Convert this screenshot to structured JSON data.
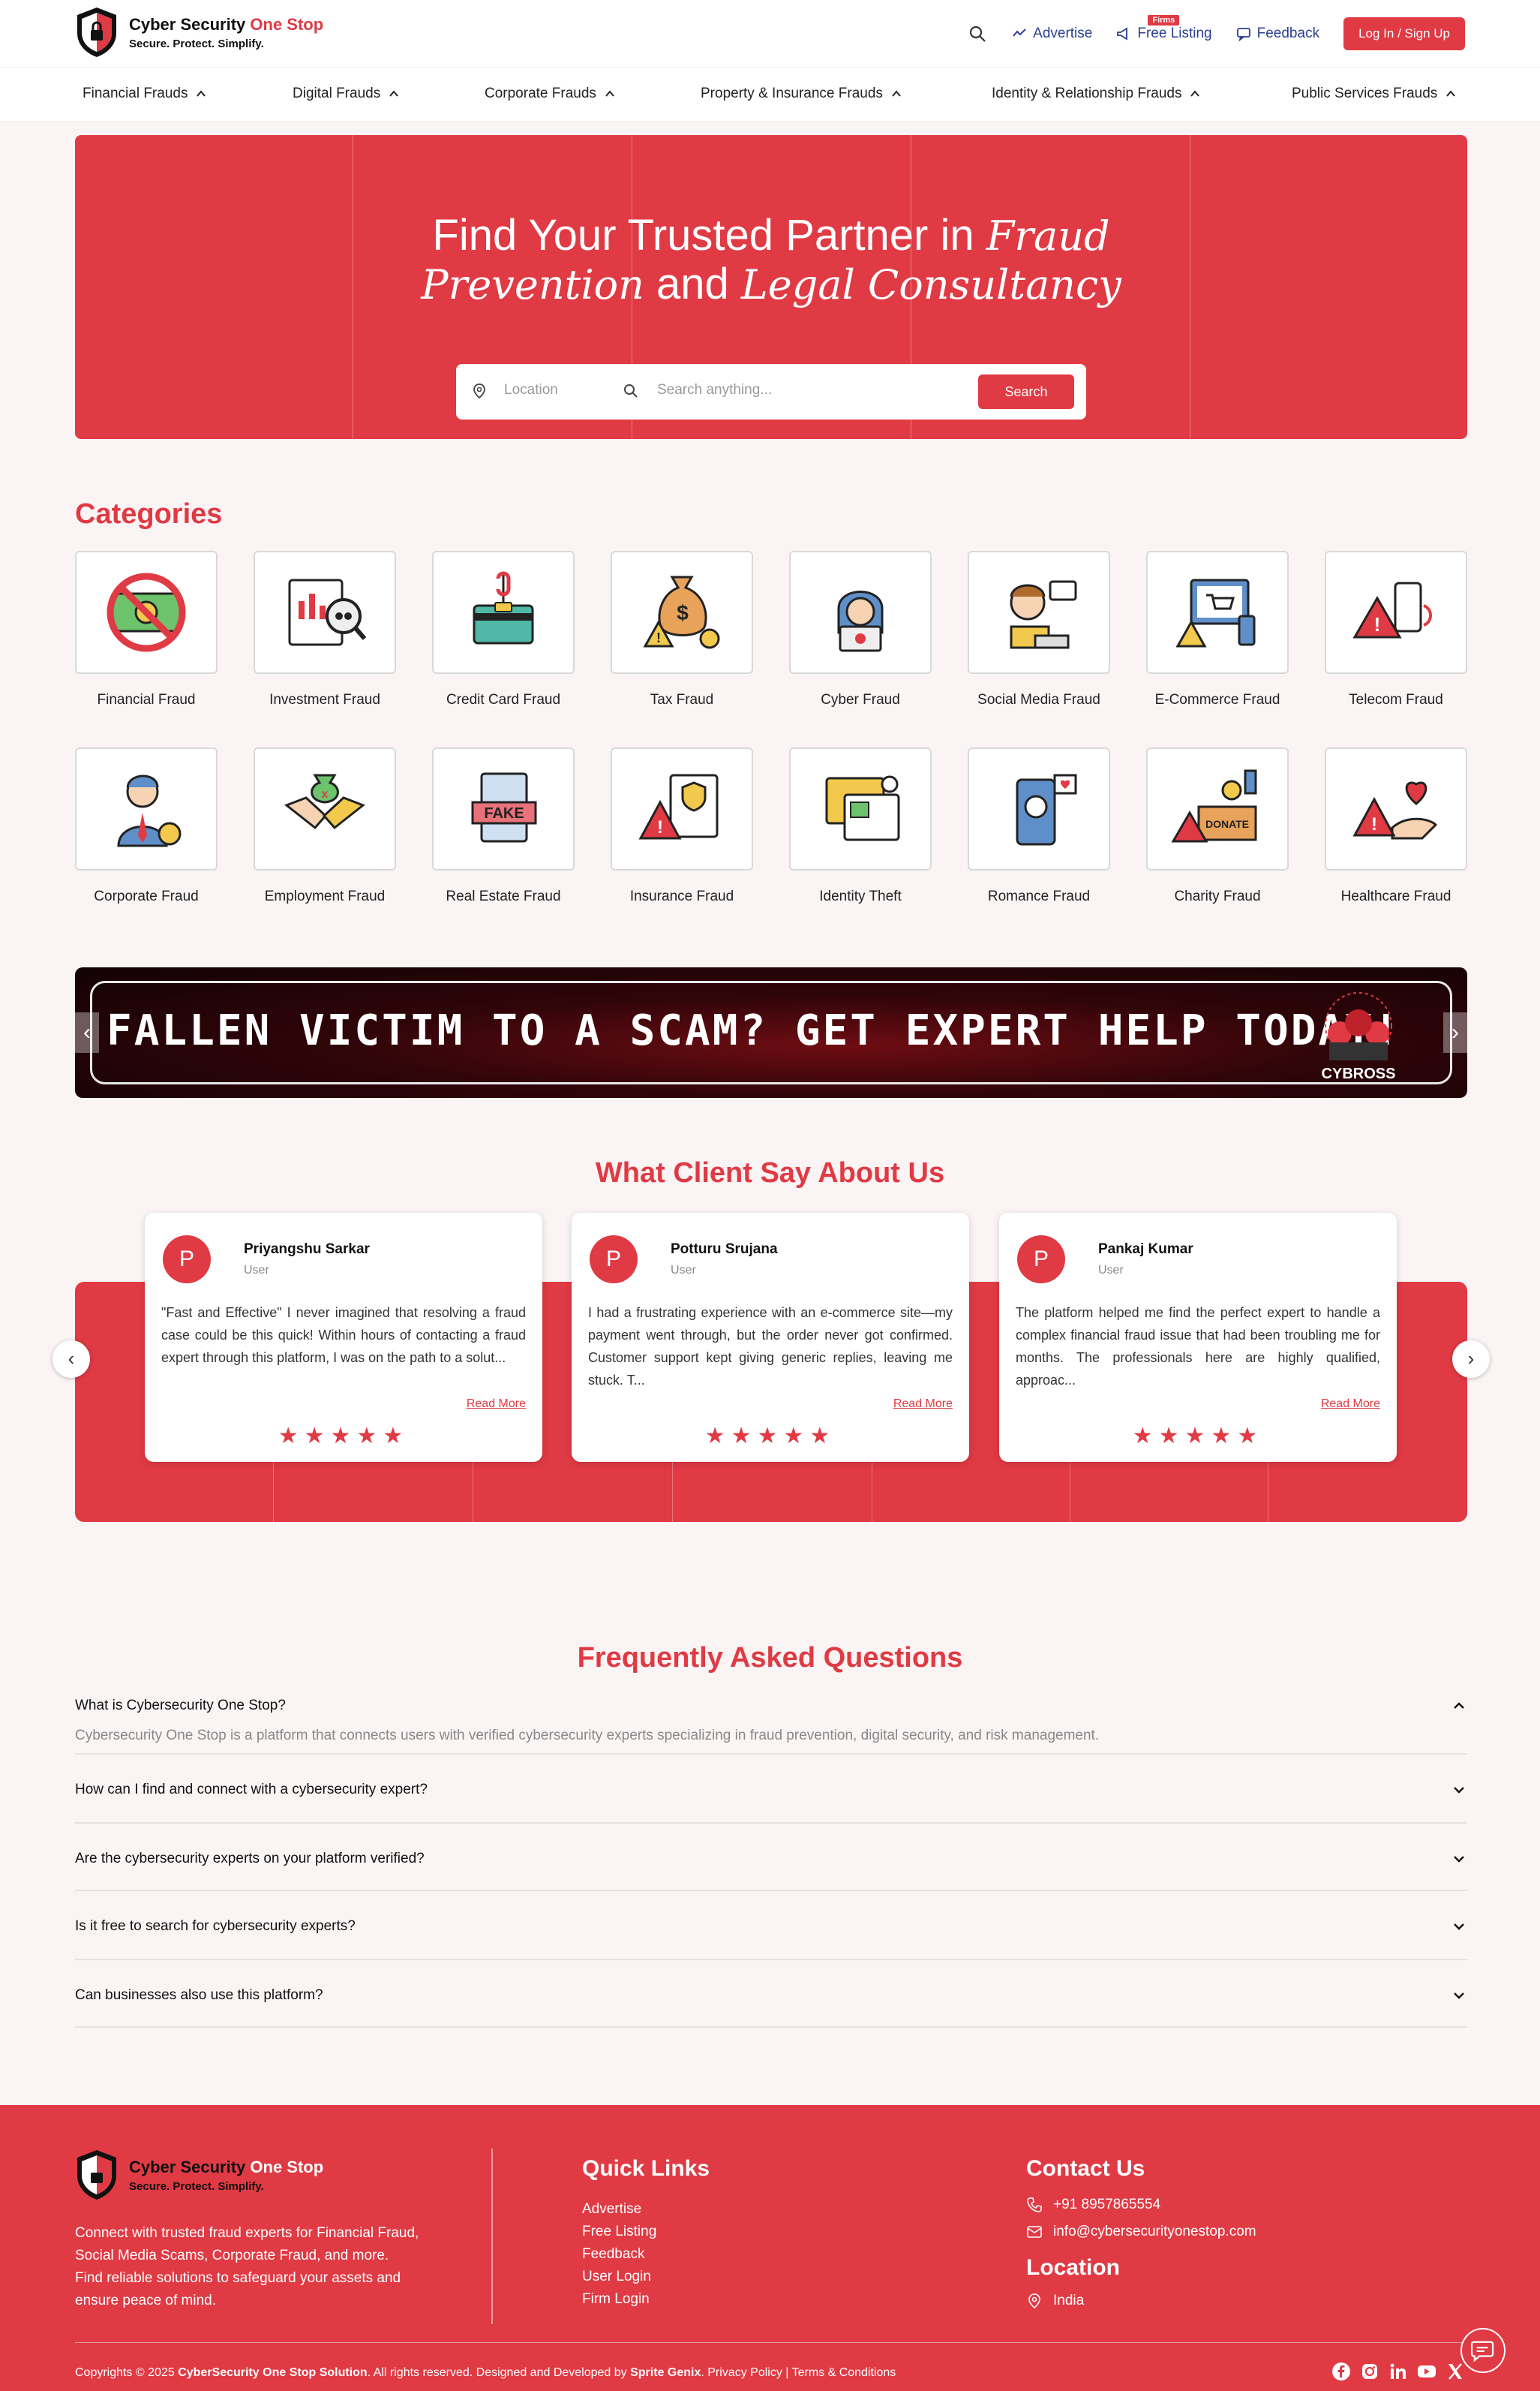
{
  "header": {
    "logo_title_1": "Cyber Security ",
    "logo_title_2": "One Stop",
    "logo_tagline": "Secure. Protect. Simplify.",
    "advertise": "Advertise",
    "free_listing": "Free Listing",
    "firms_badge": "Firms",
    "feedback": "Feedback",
    "login": "Log In / Sign Up"
  },
  "catnav": [
    "Financial Frauds",
    "Digital Frauds",
    "Corporate Frauds",
    "Property & Insurance Frauds",
    "Identity & Relationship Frauds",
    "Public Services Frauds"
  ],
  "hero": {
    "title_1": "Find Your Trusted Partner in ",
    "title_script_1": "Fraud",
    "title_script_2": "Prevention",
    "title_2": " and ",
    "title_script_3": "Legal Consultancy",
    "location_placeholder": "Location",
    "search_placeholder": "Search anything...",
    "search_button": "Search"
  },
  "categories": {
    "title": "Categories",
    "items": [
      {
        "label": "Financial Fraud",
        "icon": "no-money-icon"
      },
      {
        "label": "Investment Fraud",
        "icon": "investment-report-icon"
      },
      {
        "label": "Credit Card Fraud",
        "icon": "credit-card-hook-icon"
      },
      {
        "label": "Tax Fraud",
        "icon": "money-bag-warning-icon"
      },
      {
        "label": "Cyber Fraud",
        "icon": "hacker-icon"
      },
      {
        "label": "Social Media Fraud",
        "icon": "social-media-user-icon"
      },
      {
        "label": "E-Commerce Fraud",
        "icon": "ecommerce-warning-icon"
      },
      {
        "label": "Telecom Fraud",
        "icon": "phone-warning-icon"
      },
      {
        "label": "Corporate Fraud",
        "icon": "corporate-man-icon"
      },
      {
        "label": "Employment Fraud",
        "icon": "handshake-money-icon"
      },
      {
        "label": "Real Estate Fraud",
        "icon": "fake-document-icon"
      },
      {
        "label": "Insurance Fraud",
        "icon": "insurance-warning-icon"
      },
      {
        "label": "Identity Theft",
        "icon": "identity-document-icon"
      },
      {
        "label": "Romance Fraud",
        "icon": "romance-phone-icon"
      },
      {
        "label": "Charity Fraud",
        "icon": "donate-box-icon"
      },
      {
        "label": "Healthcare Fraud",
        "icon": "healthcare-warning-icon"
      }
    ]
  },
  "banner": {
    "text": "FALLEN VICTIM TO A SCAM? GET EXPERT HELP TODAY!",
    "brand": "CYBROSS"
  },
  "testimonials": {
    "title": "What Client Say About Us",
    "read_more": "Read More",
    "items": [
      {
        "initial": "P",
        "name": "Priyangshu Sarkar",
        "role": "User",
        "text": "\"Fast and Effective\" I never imagined that resolving a fraud case could be this quick! Within hours of contacting a fraud expert through this platform, I was on the path to a solut...",
        "rating": 5
      },
      {
        "initial": "P",
        "name": "Potturu Srujana",
        "role": "User",
        "text": "I had a frustrating experience with an e-commerce site—my payment went through, but the order never got confirmed. Customer support kept giving generic replies, leaving me stuck. T...",
        "rating": 5
      },
      {
        "initial": "P",
        "name": "Pankaj Kumar",
        "role": "User",
        "text": "The platform helped me find the perfect expert to handle a complex financial fraud issue that had been troubling me for months. The professionals here are highly qualified, approac...",
        "rating": 5
      }
    ]
  },
  "faq": {
    "title": "Frequently Asked Questions",
    "items": [
      {
        "q": "What is Cybersecurity One Stop?",
        "a": "Cybersecurity One Stop is a platform that connects users with verified cybersecurity experts specializing in fraud prevention, digital security, and risk management.",
        "open": true
      },
      {
        "q": "How can I find and connect with a cybersecurity expert?",
        "open": false
      },
      {
        "q": "Are the cybersecurity experts on your platform verified?",
        "open": false
      },
      {
        "q": "Is it free to search for cybersecurity experts?",
        "open": false
      },
      {
        "q": "Can businesses also use this platform?",
        "open": false
      }
    ]
  },
  "footer": {
    "logo_title_1": "Cyber Security ",
    "logo_title_2": "One Stop",
    "logo_tagline": "Secure. Protect. Simplify.",
    "description": "Connect with trusted fraud experts for Financial Fraud, Social Media Scams, Corporate Fraud, and more. Find reliable solutions to safeguard your assets and ensure peace of mind.",
    "quick_links_title": "Quick Links",
    "quick_links": [
      "Advertise",
      "Free Listing",
      "Feedback",
      "User Login",
      "Firm Login"
    ],
    "contact_title": "Contact Us",
    "phone": "+91 8957865554",
    "email": "info@cybersecurityonestop.com",
    "location_title": "Location",
    "location": "India",
    "copyright_1": "Copyrights © 2025 ",
    "copyright_brand": "CyberSecurity One Stop Solution",
    "copyright_2": ". All rights reserved. Designed and Developed by ",
    "copyright_dev": "Sprite Genix",
    "copyright_3": ". Privacy Policy | Terms & Conditions"
  },
  "colors": {
    "accent": "#e03a44",
    "nav_blue": "#2a3f8f",
    "background": "#fbf4f4"
  }
}
